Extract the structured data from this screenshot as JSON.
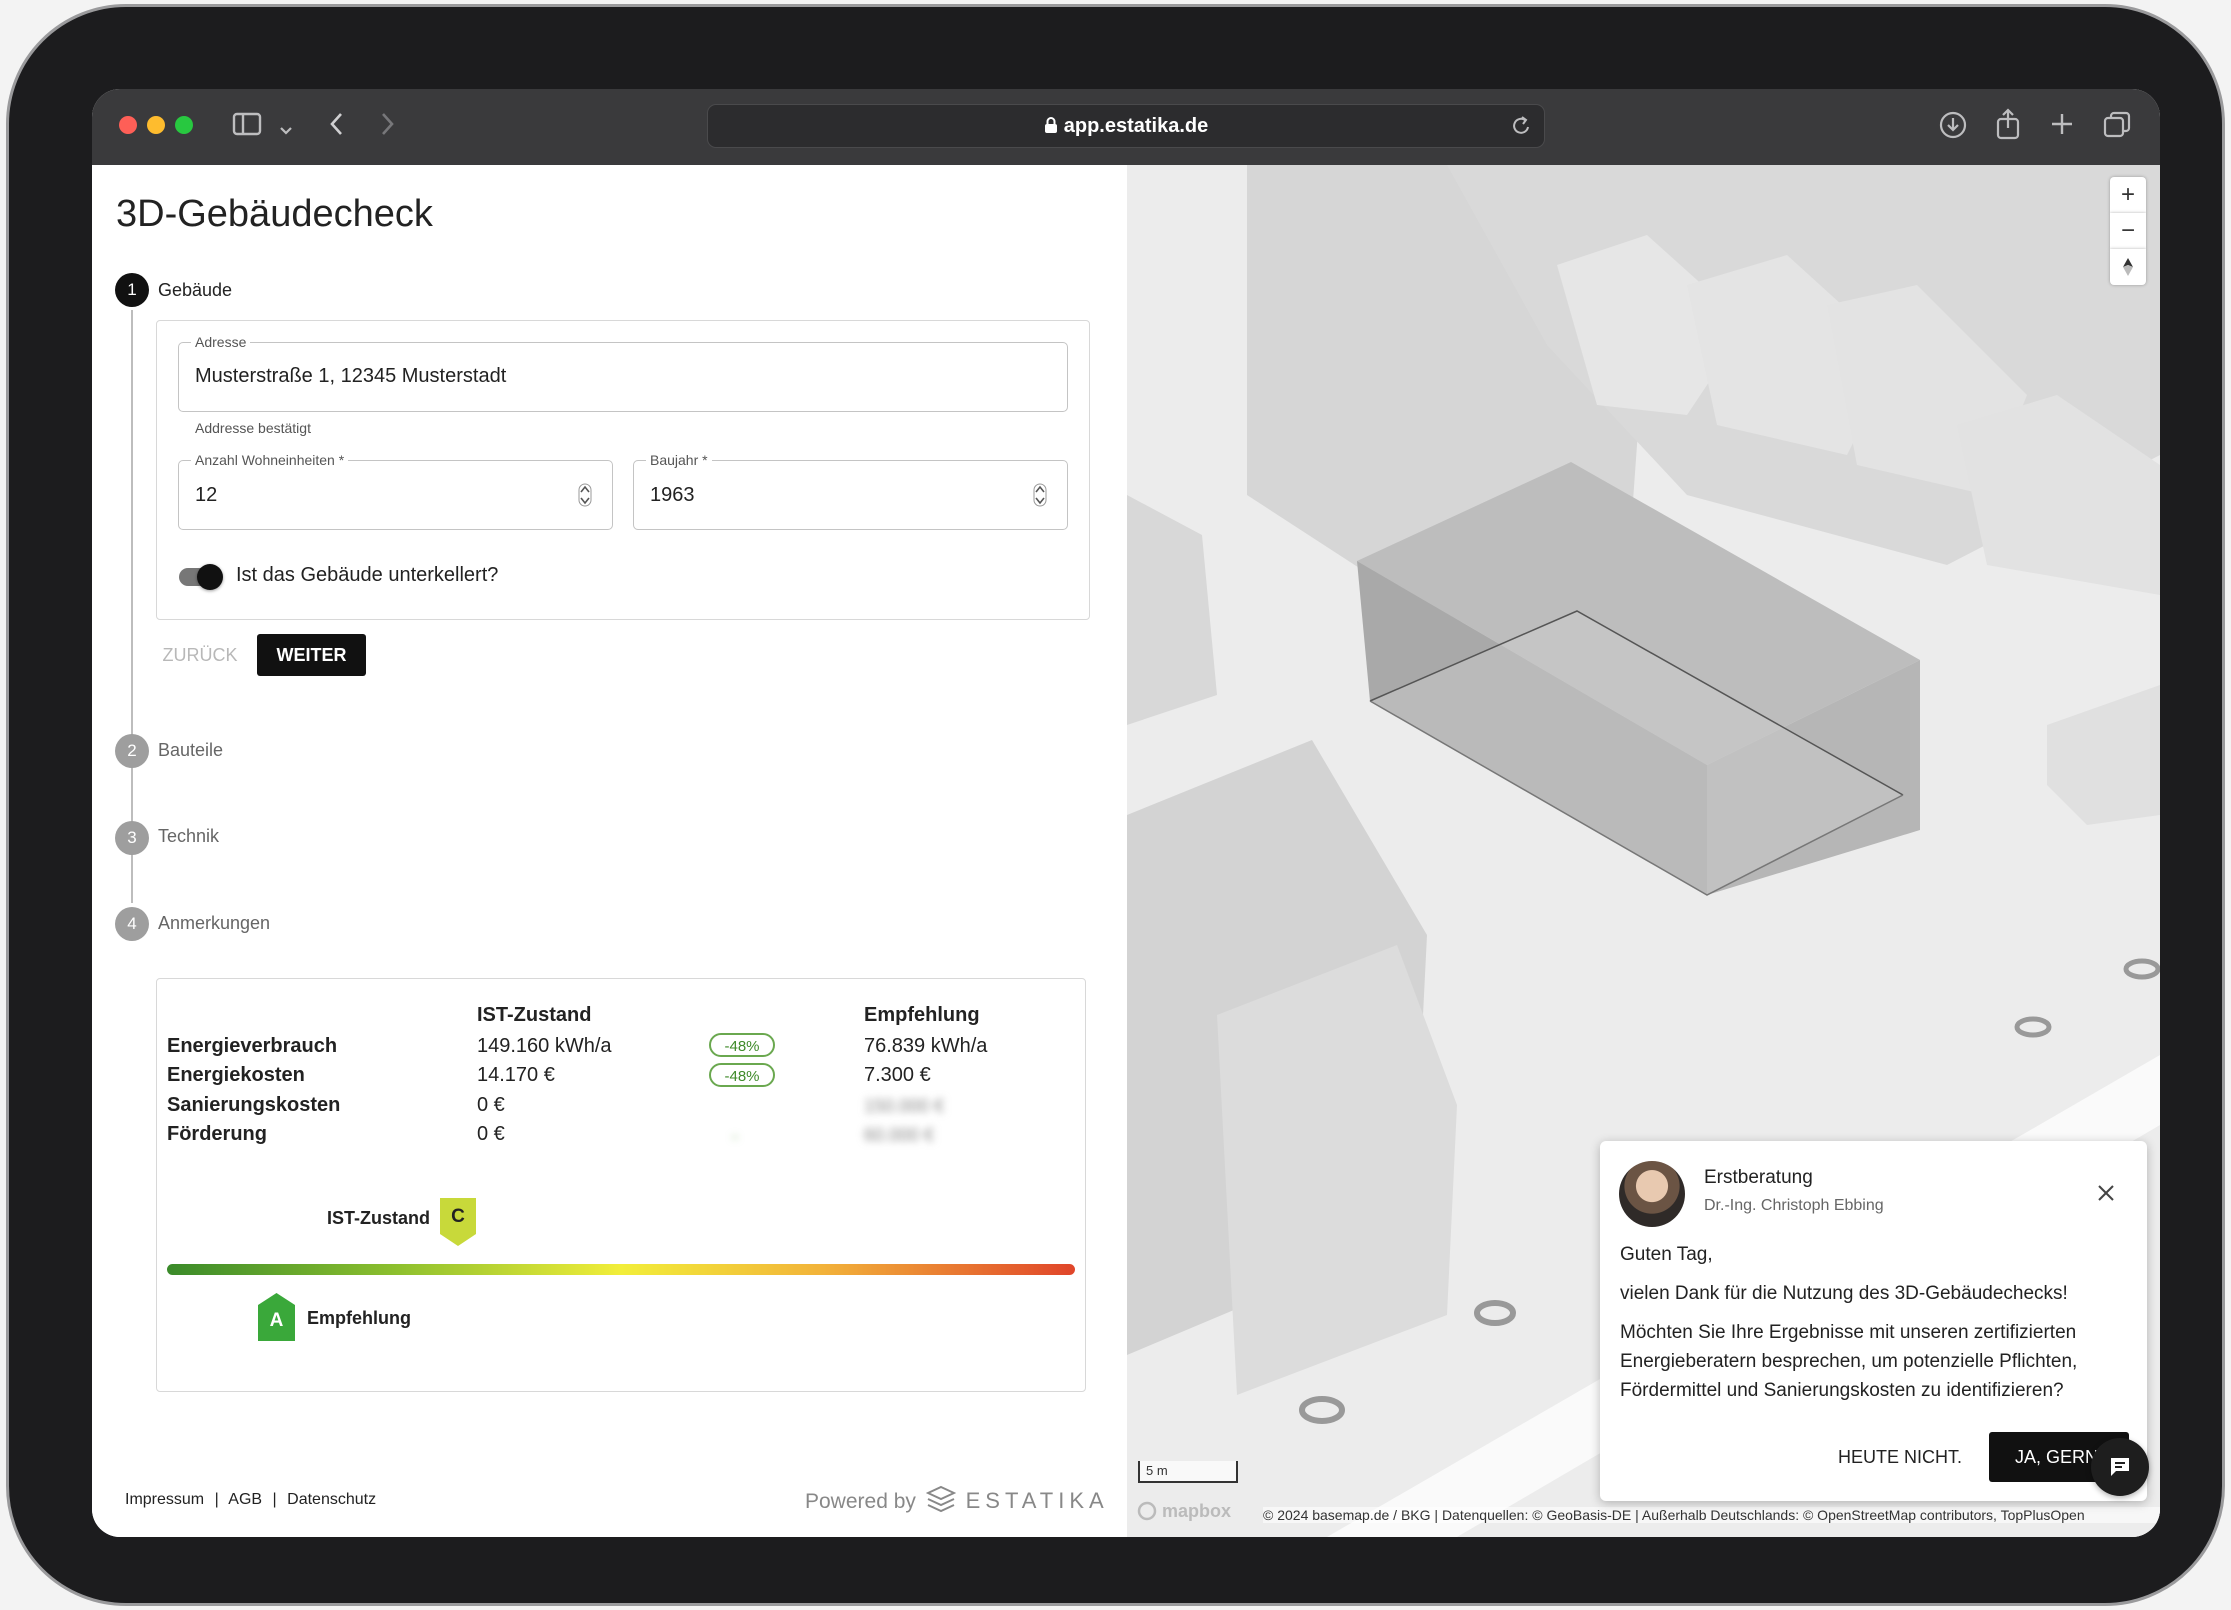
{
  "browser": {
    "url": "app.estatika.de"
  },
  "app": {
    "title": "3D-Gebäudecheck",
    "steps": [
      {
        "number": "1",
        "label": "Gebäude"
      },
      {
        "number": "2",
        "label": "Bauteile"
      },
      {
        "number": "3",
        "label": "Technik"
      },
      {
        "number": "4",
        "label": "Anmerkungen"
      }
    ],
    "form": {
      "address_label": "Adresse",
      "address_value": "Musterstraße 1, 12345 Musterstadt",
      "address_helper": "Addresse bestätigt",
      "units_label": "Anzahl Wohneinheiten *",
      "units_value": "12",
      "year_label": "Baujahr *",
      "year_value": "1963",
      "basement_label": "Ist das Gebäude unterkellert?",
      "basement_on": true
    },
    "buttons": {
      "back": "ZURÜCK",
      "next": "WEITER"
    },
    "results": {
      "col_current": "IST-Zustand",
      "col_recommend": "Empfehlung",
      "rows": [
        {
          "label": "Energieverbrauch",
          "current": "149.160 kWh/a",
          "delta": "-48%",
          "recommend": "76.839 kWh/a"
        },
        {
          "label": "Energiekosten",
          "current": "14.170 €",
          "delta": "-48%",
          "recommend": "7.300 €"
        },
        {
          "label": "Sanierungskosten",
          "current": "0 €",
          "delta": "",
          "recommend": "150.000 €"
        },
        {
          "label": "Förderung",
          "current": "0 €",
          "delta": "-",
          "recommend": "60.000 €"
        }
      ],
      "scale_current_label": "IST-Zustand",
      "scale_current_class": "C",
      "scale_recommend_label": "Empfehlung",
      "scale_recommend_class": "A"
    },
    "footer": {
      "links": [
        "Impressum",
        "AGB",
        "Datenschutz"
      ],
      "powered_by": "Powered by",
      "brand": "ESTATIKA"
    }
  },
  "map": {
    "scale_label": "5 m",
    "attribution": "© 2024 basemap.de / BKG | Datenquellen: © GeoBasis-DE | Außerhalb Deutschlands: © OpenStreetMap contributors, TopPlusOpen",
    "logo": "mapbox"
  },
  "popup": {
    "title": "Erstberatung",
    "subtitle": "Dr.-Ing. Christoph Ebbing",
    "greeting": "Guten Tag,",
    "line1": "vielen Dank für die Nutzung des 3D-Gebäudechecks!",
    "line2": "Möchten Sie Ihre Ergebnisse mit unseren zertifizierten Energieberatern besprechen, um potenzielle Pflichten, Fördermittel und Sanierungskosten zu identifizieren?",
    "btn_decline": "HEUTE NICHT.",
    "btn_accept": "JA, GERN!"
  },
  "colors": {
    "accent": "#1a1a1a",
    "badge_green": "#6aa84f",
    "class_c": "#c8d93a",
    "class_a": "#3aa83a"
  }
}
